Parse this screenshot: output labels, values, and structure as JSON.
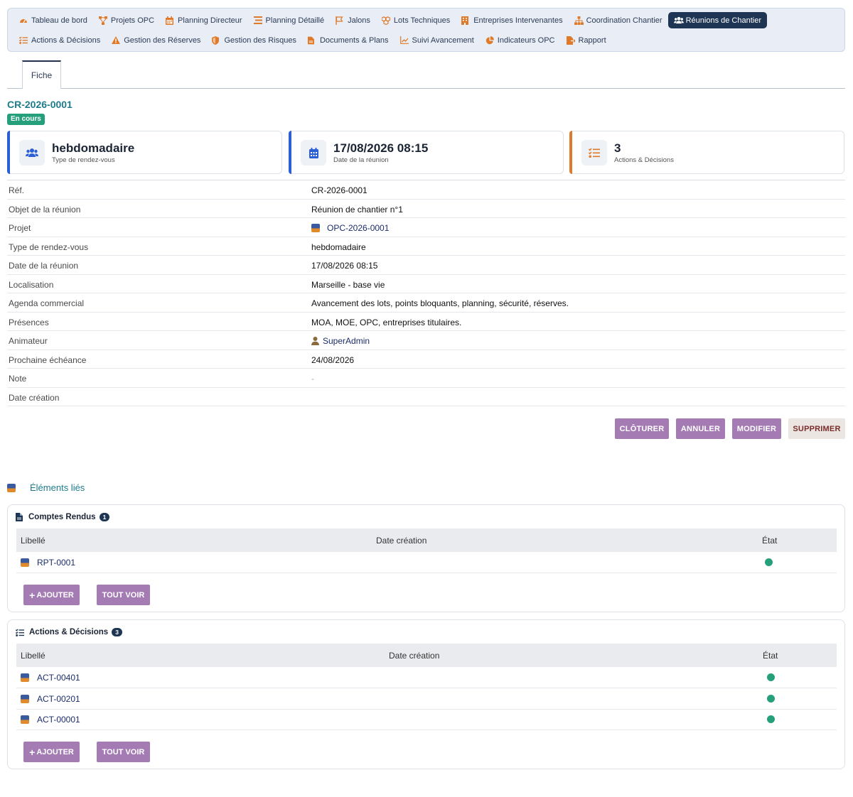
{
  "nav": {
    "row1": [
      {
        "label": "Tableau de bord",
        "icon": "dashboard-icon",
        "color": "#e07a2b"
      },
      {
        "label": "Projets OPC",
        "icon": "project-diagram-icon",
        "color": "#e07a2b"
      },
      {
        "label": "Planning Directeur",
        "icon": "calendar-icon",
        "color": "#e07a2b"
      },
      {
        "label": "Planning Détaillé",
        "icon": "tasks-icon",
        "color": "#e07a2b"
      },
      {
        "label": "Jalons",
        "icon": "flag-icon",
        "color": "#e07a2b"
      },
      {
        "label": "Lots Techniques",
        "icon": "cubes-icon",
        "color": "#e07a2b"
      },
      {
        "label": "Entreprises Intervenantes",
        "icon": "building-icon",
        "color": "#e07a2b"
      },
      {
        "label": "Coordination Chantier",
        "icon": "sitemap-icon",
        "color": "#e07a2b"
      },
      {
        "label": "Réunions de Chantier",
        "icon": "users-icon",
        "color": "#ffffff",
        "active": true
      }
    ],
    "row2": [
      {
        "label": "Actions & Décisions",
        "icon": "list-check-icon",
        "color": "#e07a2b"
      },
      {
        "label": "Gestion des Réserves",
        "icon": "warning-icon",
        "color": "#e07a2b"
      },
      {
        "label": "Gestion des Risques",
        "icon": "shield-icon",
        "color": "#e07a2b"
      },
      {
        "label": "Documents & Plans",
        "icon": "document-icon",
        "color": "#e07a2b"
      },
      {
        "label": "Suivi Avancement",
        "icon": "chart-line-icon",
        "color": "#e07a2b"
      },
      {
        "label": "Indicateurs OPC",
        "icon": "chart-pie-icon",
        "color": "#e07a2b"
      },
      {
        "label": "Rapport",
        "icon": "file-export-icon",
        "color": "#e07a2b"
      }
    ]
  },
  "tab": {
    "label": "Fiche"
  },
  "record": {
    "ref": "CR-2026-0001",
    "status": "En cours"
  },
  "cards": [
    {
      "value": "hebdomadaire",
      "label": "Type de rendez-vous",
      "accent": "#2c5fd6",
      "icon": "users-icon"
    },
    {
      "value": "17/08/2026 08:15",
      "label": "Date de la réunion",
      "accent": "#2c5fd6",
      "icon": "calendar-icon"
    },
    {
      "value": "3",
      "label": "Actions & Décisions",
      "accent": "#e07a2b",
      "icon": "list-check-icon"
    }
  ],
  "details": [
    {
      "key": "Réf.",
      "value": "CR-2026-0001"
    },
    {
      "key": "Objet de la réunion",
      "value": "Réunion de chantier n°1"
    },
    {
      "key": "Projet",
      "value": "OPC-2026-0001",
      "link": true,
      "icon": "opc-icon"
    },
    {
      "key": "Type de rendez-vous",
      "value": "hebdomadaire"
    },
    {
      "key": "Date de la réunion",
      "value": "17/08/2026 08:15"
    },
    {
      "key": "Localisation",
      "value": "Marseille - base vie"
    },
    {
      "key": "Agenda commercial",
      "value": "Avancement des lots, points bloquants, planning, sécurité, réserves."
    },
    {
      "key": "Présences",
      "value": "MOA, MOE, OPC, entreprises titulaires."
    },
    {
      "key": "Animateur",
      "value": "SuperAdmin",
      "link": true,
      "icon": "user-icon"
    },
    {
      "key": "Prochaine échéance",
      "value": "24/08/2026"
    },
    {
      "key": "Note",
      "value": "-",
      "muted": true
    },
    {
      "key": "Date création",
      "value": ""
    }
  ],
  "actions": {
    "close": "CLÔTURER",
    "cancel": "ANNULER",
    "edit": "MODIFIER",
    "delete": "SUPPRIMER"
  },
  "linked": {
    "title": "Éléments liés",
    "reports": {
      "title": "Comptes Rendus",
      "count": "1",
      "headers": {
        "label": "Libellé",
        "date": "Date création",
        "state": "État"
      },
      "rows": [
        {
          "label": "RPT-0001",
          "date": ""
        }
      ],
      "add": "AJOUTER",
      "all": "TOUT VOIR"
    },
    "decisions": {
      "title": "Actions & Décisions",
      "count": "3",
      "headers": {
        "label": "Libellé",
        "date": "Date création",
        "state": "État"
      },
      "rows": [
        {
          "label": "ACT-00401",
          "date": ""
        },
        {
          "label": "ACT-00201",
          "date": ""
        },
        {
          "label": "ACT-00001",
          "date": ""
        }
      ],
      "add": "AJOUTER",
      "all": "TOUT VOIR"
    }
  },
  "colors": {
    "accent_teal": "#1d7c8c",
    "status_green": "#25a07a",
    "button_purple": "#a47cb3",
    "nav_active": "#1f3554"
  }
}
